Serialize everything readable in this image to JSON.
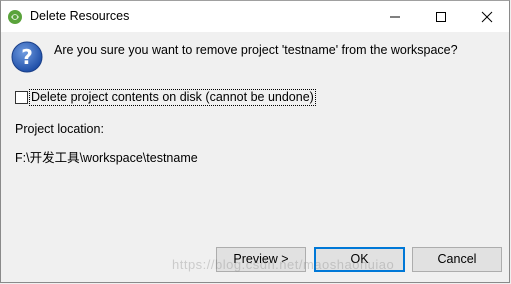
{
  "window": {
    "title": "Delete Resources",
    "controls": [
      "minimize-icon",
      "maximize-icon",
      "close-icon"
    ]
  },
  "dialog": {
    "icon": "question-icon",
    "message": "Are you sure you want to remove project 'testname' from the workspace?",
    "checkbox": {
      "label": "Delete project contents on disk (cannot be undone)",
      "checked": false
    },
    "location_label": "Project location:",
    "location_value": "F:\\开发工具\\workspace\\testname"
  },
  "buttons": {
    "preview": "Preview >",
    "ok": "OK",
    "cancel": "Cancel"
  },
  "watermark": "https://blog.csdn.net/maoshaohuiao",
  "colors": {
    "titlebar": "#ffffff",
    "body": "#f0f0f0",
    "default_button_border": "#0078d7",
    "question_icon": "#1f4fa8"
  }
}
